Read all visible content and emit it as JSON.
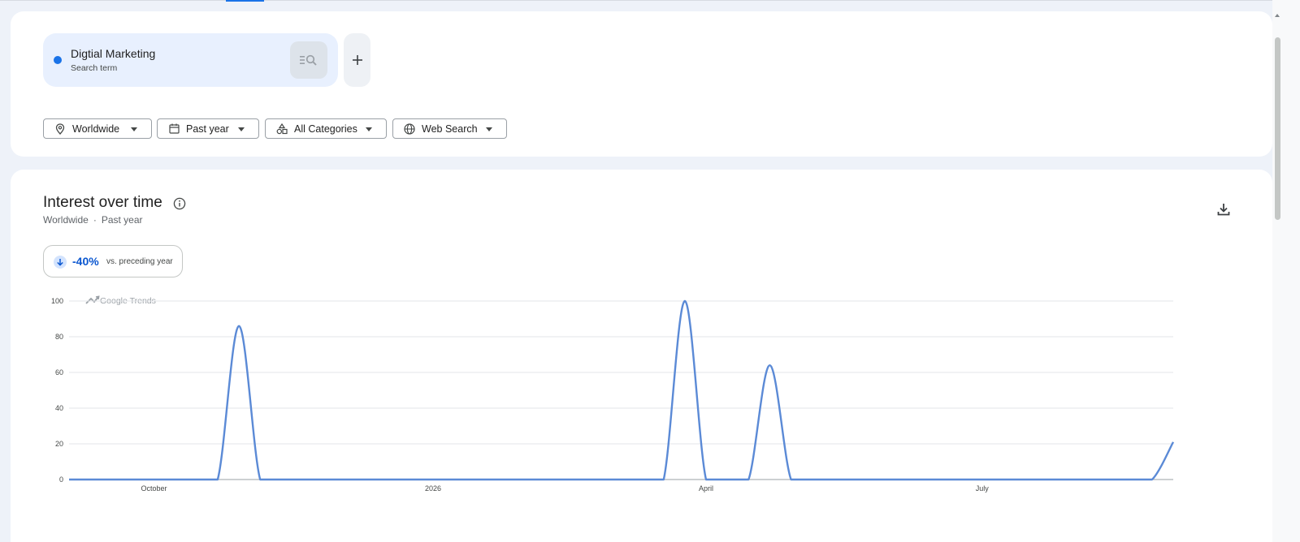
{
  "search_term": {
    "name": "Digtial Marketing",
    "type": "Search term",
    "color": "#1a73e8"
  },
  "filters": [
    {
      "label": "Worldwide",
      "icon": "location-pin-icon"
    },
    {
      "label": "Past year",
      "icon": "calendar-icon"
    },
    {
      "label": "All Categories",
      "icon": "categories-icon"
    },
    {
      "label": "Web Search",
      "icon": "globe-icon"
    }
  ],
  "interest": {
    "title": "Interest over time",
    "region": "Worldwide",
    "sep": "·",
    "period": "Past year",
    "change_value": "-40%",
    "change_label": "vs. preceding year",
    "watermark": "Google Trends"
  },
  "chart_data": {
    "type": "line",
    "title": "",
    "xlabel": "",
    "ylabel": "",
    "ylim": [
      0,
      100
    ],
    "yticks": [
      0,
      20,
      40,
      60,
      80,
      100
    ],
    "xticks": [
      {
        "label": "October",
        "date": "2025-10-01"
      },
      {
        "label": "2026",
        "date": "2026-01-01"
      },
      {
        "label": "April",
        "date": "2026-04-01"
      },
      {
        "label": "July",
        "date": "2026-07-01"
      }
    ],
    "grid": true,
    "color": "#1a73e8",
    "series": [
      {
        "x": [
          "2025-09-03",
          "2025-09-10",
          "2025-09-17",
          "2025-09-24",
          "2025-10-01",
          "2025-10-08",
          "2025-10-15",
          "2025-10-22",
          "2025-10-29",
          "2025-11-05",
          "2025-11-12",
          "2025-11-19",
          "2025-11-26",
          "2025-12-03",
          "2025-12-10",
          "2025-12-17",
          "2025-12-24",
          "2025-12-31",
          "2026-01-07",
          "2026-01-14",
          "2026-01-21",
          "2026-01-28",
          "2026-02-04",
          "2026-02-11",
          "2026-02-18",
          "2026-02-25",
          "2026-03-04",
          "2026-03-11",
          "2026-03-18",
          "2026-03-25",
          "2026-04-01",
          "2026-04-08",
          "2026-04-15",
          "2026-04-22",
          "2026-04-29",
          "2026-05-06",
          "2026-05-13",
          "2026-05-20",
          "2026-05-27",
          "2026-06-03",
          "2026-06-10",
          "2026-06-17",
          "2026-06-24",
          "2026-07-01",
          "2026-07-08",
          "2026-07-15",
          "2026-07-22",
          "2026-07-29",
          "2026-08-05",
          "2026-08-12",
          "2026-08-19",
          "2026-08-26",
          "2026-09-02"
        ],
        "y": [
          0,
          0,
          0,
          0,
          0,
          0,
          0,
          0,
          86,
          0,
          0,
          0,
          0,
          0,
          0,
          0,
          0,
          0,
          0,
          0,
          0,
          0,
          0,
          0,
          0,
          0,
          0,
          0,
          0,
          100,
          0,
          0,
          0,
          64,
          0,
          0,
          0,
          0,
          0,
          0,
          0,
          0,
          0,
          0,
          0,
          0,
          0,
          0,
          0,
          0,
          0,
          0,
          21
        ]
      }
    ]
  }
}
